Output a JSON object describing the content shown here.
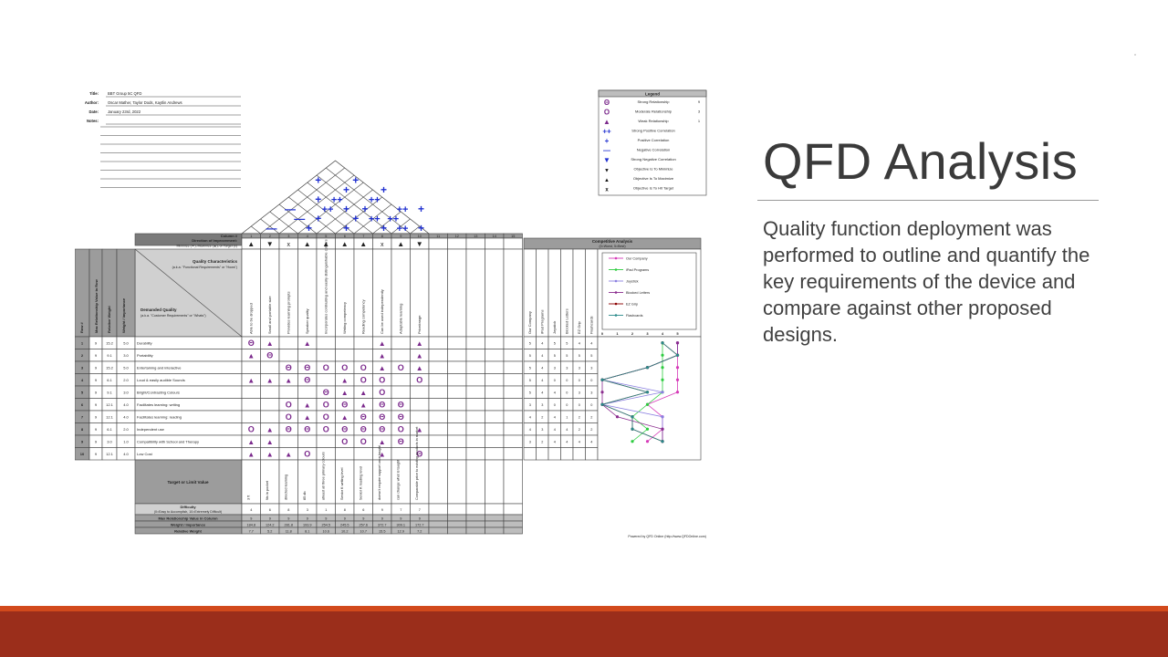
{
  "slide": {
    "title": "QFD Analysis",
    "body": "Quality function deployment was performed to outline and quantify the key requirements of the device and compare against other proposed designs."
  },
  "colors": {
    "accent": "#9b2e1b",
    "accent_line": "#d24a1c",
    "strong": "#7b2a8c",
    "positive": "#1f2fd0"
  },
  "qfd": {
    "info": [
      {
        "label": "Title:",
        "value": "BBT Group 5C QFD"
      },
      {
        "label": "Author:",
        "value": "Oscar Mather, Taylor Dods, Kaytlin Andrews"
      },
      {
        "label": "Date:",
        "value": "January 23rd, 2022"
      },
      {
        "label": "Notes:",
        "value": ""
      }
    ],
    "legend": {
      "title": "Legend",
      "items": [
        {
          "symbol": "Θ",
          "label": "Strong Relationship",
          "value": "9"
        },
        {
          "symbol": "O",
          "label": "Moderate Relationship",
          "value": "3"
        },
        {
          "symbol": "▲",
          "label": "Weak Relationship",
          "value": "1"
        },
        {
          "symbol": "++",
          "label": "Strong Positive Correlation",
          "value": ""
        },
        {
          "symbol": "+",
          "label": "Positive Correlation",
          "value": ""
        },
        {
          "symbol": "—",
          "label": "Negative Correlation",
          "value": ""
        },
        {
          "symbol": "▼",
          "label": "Strong Negative Correlation",
          "value": ""
        },
        {
          "symbol": "▼",
          "label": "Objective Is To Minimize",
          "value": ""
        },
        {
          "symbol": "▲",
          "label": "Objective Is To Maximize",
          "value": ""
        },
        {
          "symbol": "x",
          "label": "Objective Is To Hit Target",
          "value": ""
        }
      ]
    },
    "roof_marks": [
      {
        "sym": "+",
        "r": 0,
        "c": 3
      },
      {
        "sym": "+",
        "r": 0,
        "c": 5
      },
      {
        "sym": "+",
        "r": 1,
        "c": 4
      },
      {
        "sym": "+",
        "r": 1,
        "c": 6
      },
      {
        "sym": "+",
        "r": 2,
        "c": 3
      },
      {
        "sym": "++",
        "r": 2,
        "c": 4
      },
      {
        "sym": "++",
        "r": 2,
        "c": 6
      },
      {
        "sym": "—",
        "r": 3,
        "c": 1
      },
      {
        "sym": "++",
        "r": 3,
        "c": 3
      },
      {
        "sym": "+",
        "r": 3,
        "c": 4
      },
      {
        "sym": "+",
        "r": 3,
        "c": 5
      },
      {
        "sym": "++",
        "r": 3,
        "c": 7
      },
      {
        "sym": "+",
        "r": 3,
        "c": 8
      },
      {
        "sym": "—",
        "r": 4,
        "c": 2
      },
      {
        "sym": "+",
        "r": 4,
        "c": 3
      },
      {
        "sym": "+",
        "r": 4,
        "c": 5
      },
      {
        "sym": "++",
        "r": 4,
        "c": 6
      },
      {
        "sym": "++",
        "r": 4,
        "c": 7
      },
      {
        "sym": "—",
        "r": 5,
        "c": 0
      },
      {
        "sym": "+",
        "r": 5,
        "c": 2
      },
      {
        "sym": "+",
        "r": 5,
        "c": 4
      },
      {
        "sym": "+",
        "r": 5,
        "c": 6
      },
      {
        "sym": "++",
        "r": 5,
        "c": 7
      },
      {
        "sym": "+",
        "r": 5,
        "c": 8
      }
    ],
    "column_label": "Column #",
    "columns": [
      "1",
      "2",
      "3",
      "4",
      "5",
      "6",
      "7",
      "8",
      "9",
      "10",
      "11",
      "12",
      "13",
      "14",
      "15"
    ],
    "direction_label": "Direction of Improvement:",
    "direction_sublabel": "Minimize (▼), Maximize (▲), or Target (x)",
    "directions": [
      "▲",
      "▼",
      "x",
      "▲",
      "▲",
      "▲",
      "▲",
      "x",
      "▲",
      "▼",
      "",
      "",
      "",
      "",
      ""
    ],
    "hows_heading": "Quality Characteristics",
    "hows_heading_note": "(a.k.a. \"Functional Requirements\" or \"Hows\")",
    "whats_heading": "Demanded Quality",
    "whats_heading_note": "(a.k.a. \"Customer Requirements\" or \"Whats\")",
    "hows": [
      "Able to be dropped",
      "Small and portable size",
      "Provides learning prompts",
      "Speaker quality",
      "Incorporates contrasting and easily distinguishable colours",
      "Writing competency",
      "Reading competency",
      "Can be used independently",
      "Adaptable learning",
      "Price/range",
      "",
      "",
      "",
      "",
      ""
    ],
    "row_side_headers": [
      "Row #",
      "Max Relationship Value in Row",
      "Relative Weight",
      "Weight / Importance"
    ],
    "rows": [
      {
        "n": "1",
        "max": "9",
        "rel": "15.2",
        "wt": "5.0",
        "what": "Durability",
        "rels": [
          "Θ",
          "▲",
          "",
          "▲",
          "",
          "",
          "",
          "▲",
          "",
          "▲"
        ]
      },
      {
        "n": "2",
        "max": "9",
        "rel": "9.1",
        "wt": "3.0",
        "what": "Portability",
        "rels": [
          "▲",
          "Θ",
          "",
          "",
          "",
          "",
          "",
          "▲",
          "",
          "▲"
        ]
      },
      {
        "n": "3",
        "max": "9",
        "rel": "15.2",
        "wt": "5.0",
        "what": "Entertaining and interactive",
        "rels": [
          "",
          "",
          "Θ",
          "Θ",
          "O",
          "O",
          "O",
          "▲",
          "O",
          "▲"
        ]
      },
      {
        "n": "4",
        "max": "9",
        "rel": "6.1",
        "wt": "2.0",
        "what": "Loud & easily audible Sounds",
        "rels": [
          "▲",
          "▲",
          "▲",
          "Θ",
          "",
          "▲",
          "O",
          "O",
          "",
          "O"
        ]
      },
      {
        "n": "5",
        "max": "9",
        "rel": "9.1",
        "wt": "3.0",
        "what": "Bright/Contrasting Colours",
        "rels": [
          "",
          "",
          "",
          "",
          "Θ",
          "▲",
          "▲",
          "O",
          "",
          ""
        ]
      },
      {
        "n": "6",
        "max": "9",
        "rel": "12.1",
        "wt": "4.0",
        "what": "Facilitates learning: writing",
        "rels": [
          "",
          "",
          "O",
          "▲",
          "O",
          "Θ",
          "▲",
          "Θ",
          "Θ",
          ""
        ]
      },
      {
        "n": "7",
        "max": "9",
        "rel": "12.1",
        "wt": "4.0",
        "what": "Facilitates learning: reading",
        "rels": [
          "",
          "",
          "O",
          "▲",
          "O",
          "▲",
          "Θ",
          "Θ",
          "Θ",
          ""
        ]
      },
      {
        "n": "8",
        "max": "9",
        "rel": "6.1",
        "wt": "2.0",
        "what": "Independent use",
        "rels": [
          "O",
          "▲",
          "Θ",
          "Θ",
          "O",
          "Θ",
          "Θ",
          "Θ",
          "O",
          "▲"
        ]
      },
      {
        "n": "9",
        "max": "9",
        "rel": "3.0",
        "wt": "1.0",
        "what": "Compatibility with School and Therapy",
        "rels": [
          "▲",
          "▲",
          "",
          "",
          "",
          "O",
          "O",
          "▲",
          "Θ",
          ""
        ]
      },
      {
        "n": "10",
        "max": "9",
        "rel": "12.1",
        "wt": "4.0",
        "what": "Low Cost",
        "rels": [
          "▲",
          "▲",
          "▲",
          "O",
          "",
          "",
          "",
          "▲",
          "",
          "Θ"
        ]
      }
    ],
    "target_label": "Target or Limit Value",
    "targets": [
      "3 ft",
      "fits in pocket",
      "directed learning",
      "85 db",
      "atleast all three primary colours",
      "Senior K writing level",
      "Senior K reading level",
      "doesn't require support once taught",
      "can change what is taught",
      "Comparable price to existing products in market"
    ],
    "difficulty_label": "Difficulty",
    "difficulty_note": "(0=Easy to Accomplish, 10=Extremely Difficult)",
    "difficulty": [
      "4",
      "6",
      "8",
      "3",
      "1",
      "8",
      "6",
      "9",
      "7",
      "7"
    ],
    "max_col_label": "Max Relationship Value in Column",
    "max_col": [
      "9",
      "9",
      "9",
      "9",
      "9",
      "9",
      "9",
      "9",
      "9",
      "9"
    ],
    "weight_label": "Weight / Importance",
    "weight": [
      "184.8",
      "124.2",
      "281.8",
      "193.9",
      "254.5",
      "245.5",
      "257.6",
      "372.7",
      "309.1",
      "172.7"
    ],
    "relweight_label": "Relative Weight",
    "relweight": [
      "7.7",
      "5.2",
      "11.8",
      "8.1",
      "10.6",
      "10.2",
      "10.7",
      "15.5",
      "12.9",
      "7.2"
    ],
    "competitive": {
      "title": "Competitive Analysis",
      "subtitle": "(0=Worst, 5=Best)",
      "products": [
        "Our Company",
        "iPad Programs",
        "Joystick",
        "Blocked Letters",
        "EZ Grip",
        "Flashcards"
      ],
      "scores": [
        [
          "5",
          "4",
          "5",
          "5",
          "4",
          "4"
        ],
        [
          "5",
          "4",
          "5",
          "5",
          "5",
          "5"
        ],
        [
          "5",
          "4",
          "3",
          "3",
          "3",
          "3"
        ],
        [
          "5",
          "4",
          "0",
          "0",
          "0",
          "0"
        ],
        [
          "5",
          "4",
          "4",
          "0",
          "3",
          "3"
        ],
        [
          "3",
          "3",
          "0",
          "0",
          "0",
          "0"
        ],
        [
          "4",
          "2",
          "4",
          "1",
          "2",
          "2"
        ],
        [
          "4",
          "3",
          "4",
          "4",
          "2",
          "2"
        ],
        [
          "3",
          "2",
          "4",
          "4",
          "4",
          "4"
        ],
        [
          "",
          "",
          "",
          "",
          "",
          ""
        ]
      ],
      "axis": [
        "0",
        "1",
        "2",
        "3",
        "4",
        "5"
      ],
      "colors": [
        "#d63ab8",
        "#2ecc40",
        "#8a7fe0",
        "#8b2c8e",
        "#8b0000",
        "#2a8a8a"
      ]
    },
    "powered_by": "Powered by QFD Online (http://www.QFDOnline.com)"
  }
}
